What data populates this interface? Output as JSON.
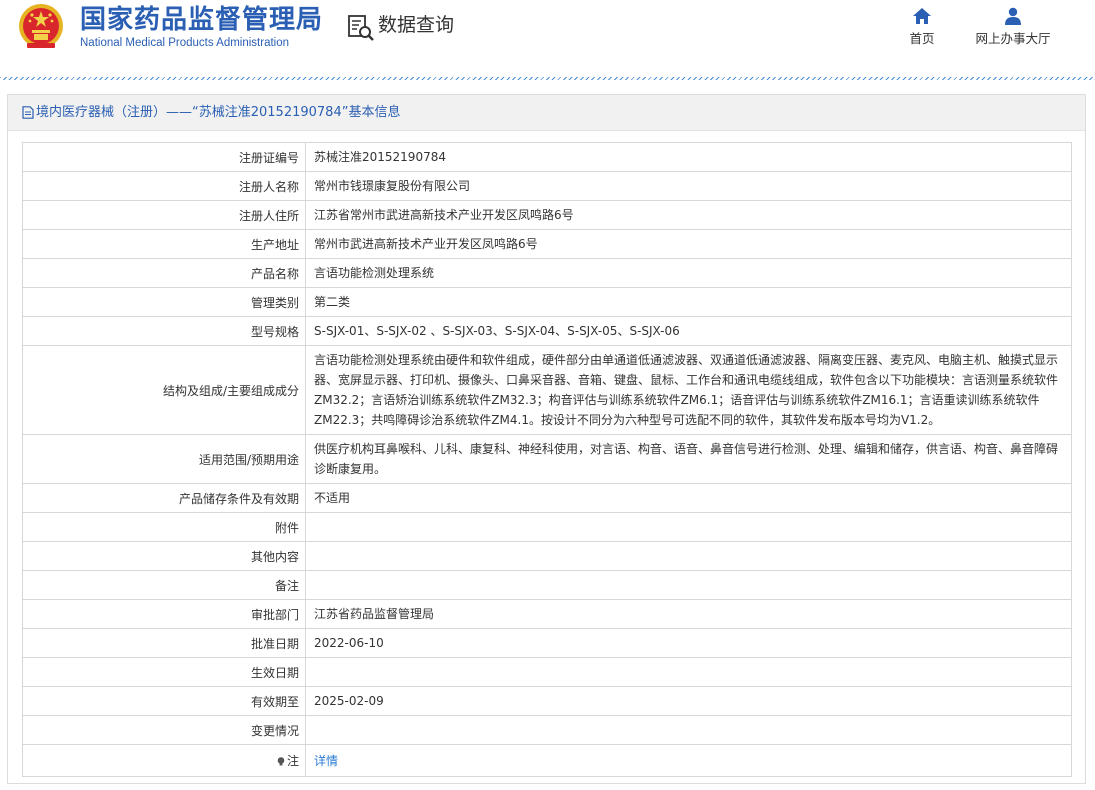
{
  "site": {
    "title": "国家药品监督管理局",
    "subtitle": "National Medical Products Administration",
    "query_label": "数据查询",
    "nav": {
      "home": "首页",
      "hall": "网上办事大厅"
    },
    "icons": {
      "query": "magnifier-document-icon",
      "home": "home-icon",
      "hall": "user-icon"
    },
    "colors": {
      "brand": "#2a5fb3",
      "link": "#2a7bd6"
    }
  },
  "panel": {
    "title": "境内医疗器械（注册）——“苏械注准20152190784”基本信息"
  },
  "rows": [
    {
      "label": "注册证编号",
      "value": "苏械注准20152190784"
    },
    {
      "label": "注册人名称",
      "value": "常州市钱璟康复股份有限公司"
    },
    {
      "label": "注册人住所",
      "value": "江苏省常州市武进高新技术产业开发区凤鸣路6号"
    },
    {
      "label": "生产地址",
      "value": "常州市武进高新技术产业开发区凤鸣路6号"
    },
    {
      "label": "产品名称",
      "value": "言语功能检测处理系统"
    },
    {
      "label": "管理类别",
      "value": "第二类"
    },
    {
      "label": "型号规格",
      "value": "S-SJX-01、S-SJX-02 、S-SJX-03、S-SJX-04、S-SJX-05、S-SJX-06"
    },
    {
      "label": "结构及组成/主要组成成分",
      "value": "言语功能检测处理系统由硬件和软件组成，硬件部分由单通道低通滤波器、双通道低通滤波器、隔离变压器、麦克风、电脑主机、触摸式显示器、宽屏显示器、打印机、摄像头、口鼻采音器、音箱、键盘、鼠标、工作台和通讯电缆线组成，软件包含以下功能模块：言语测量系统软件ZM32.2；言语矫治训练系统软件ZM32.3；构音评估与训练系统软件ZM6.1；语音评估与训练系统软件ZM16.1；言语重读训练系统软件ZM22.3；共鸣障碍诊治系统软件ZM4.1。按设计不同分为六种型号可选配不同的软件，其软件发布版本号均为V1.2。"
    },
    {
      "label": "适用范围/预期用途",
      "value": "供医疗机构耳鼻喉科、儿科、康复科、神经科使用，对言语、构音、语音、鼻音信号进行检测、处理、编辑和储存，供言语、构音、鼻音障碍诊断康复用。"
    },
    {
      "label": "产品储存条件及有效期",
      "value": "不适用"
    },
    {
      "label": "附件",
      "value": ""
    },
    {
      "label": "其他内容",
      "value": ""
    },
    {
      "label": "备注",
      "value": ""
    },
    {
      "label": "审批部门",
      "value": "江苏省药品监督管理局"
    },
    {
      "label": "批准日期",
      "value": "2022-06-10"
    },
    {
      "label": "生效日期",
      "value": ""
    },
    {
      "label": "有效期至",
      "value": "2025-02-09"
    },
    {
      "label": "变更情况",
      "value": ""
    },
    {
      "label": "注",
      "value": "详情"
    }
  ]
}
